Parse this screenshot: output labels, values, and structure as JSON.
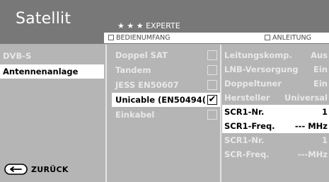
{
  "header": {
    "title": "Satellit",
    "mode": "★ ★ ★ EXPERTE",
    "legend_left": "BEDIENUMFANG",
    "legend_right": "ANLEITUNG"
  },
  "col1": {
    "items": [
      {
        "label": "DVB-S"
      },
      {
        "label": "Antennenanlage"
      }
    ],
    "back_label": "ZURÜCK",
    "back_icon": "back-arrow-icon"
  },
  "col2": {
    "items": [
      {
        "label": "Doppel SAT",
        "checked": false
      },
      {
        "label": "Tandem",
        "checked": false
      },
      {
        "label": "JESS EN50607",
        "checked": false
      },
      {
        "label": "Unicable (EN50494(",
        "checked": true,
        "check": "✔"
      },
      {
        "label": "Einkabel",
        "checked": false
      }
    ]
  },
  "col3": {
    "items": [
      {
        "label": "Leitungskomp.",
        "value": "Aus"
      },
      {
        "label": "LNB-Versorgung",
        "value": "Ein"
      },
      {
        "label": "Doppeltuner",
        "value": "Ein"
      },
      {
        "label": "Hersteller",
        "value": "Universal"
      },
      {
        "label": "SCR1-Nr.",
        "value": "1"
      },
      {
        "label": "SCR1-Freq.",
        "value": "--- MHz"
      },
      {
        "label": "SCR1-Nr.",
        "value": "1"
      },
      {
        "label": "SCR-Freq.",
        "value": "---MHz"
      }
    ]
  },
  "colors": {
    "header_bg": "#787878",
    "panel_bg": "#b5b5b5",
    "selected_bg": "#ffffff"
  }
}
